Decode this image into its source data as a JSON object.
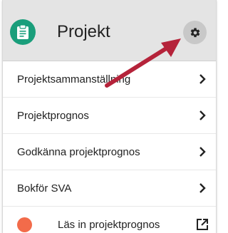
{
  "header": {
    "title": "Projekt",
    "icon": "clipboard-icon",
    "icon_color": "#1a9e7b",
    "settings_icon": "gear-icon"
  },
  "menu": {
    "items": [
      {
        "label": "Projektsammanställning",
        "icon": "chevron-right-icon"
      },
      {
        "label": "Projektprognos",
        "icon": "chevron-right-icon"
      },
      {
        "label": "Godkänna projektprognos",
        "icon": "chevron-right-icon"
      },
      {
        "label": "Bokför SVA",
        "icon": "chevron-right-icon"
      },
      {
        "label": "Läs in projektprognos",
        "icon": "external-link-icon",
        "dot_color": "#f26b4a"
      }
    ]
  },
  "annotation": {
    "arrow_color": "#b5233a"
  }
}
